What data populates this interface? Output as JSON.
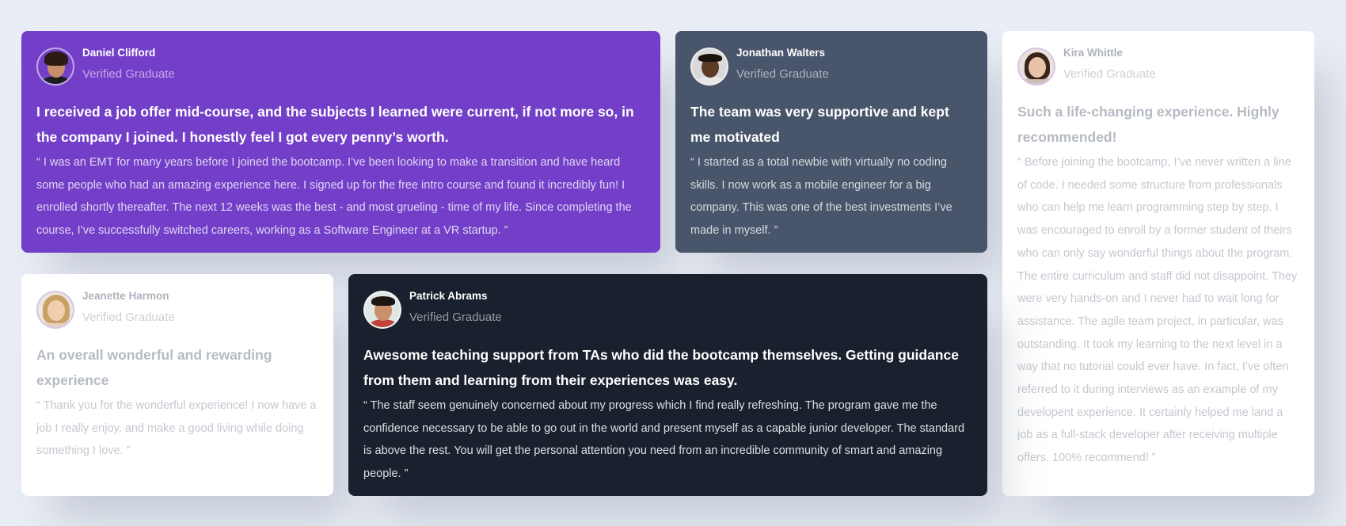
{
  "testimonials": [
    {
      "name": "Daniel Clifford",
      "role": "Verified Graduate",
      "headline": "I received a job offer mid-course, and the subjects I learned were current, if not more so, in the company I joined. I honestly feel I got every penny’s worth.",
      "quote": "“ I was an EMT for many years before I joined the bootcamp. I’ve been looking to make a transition and have heard some people who had an amazing experience here. I signed up for the free intro course and found it incredibly fun! I enrolled shortly thereafter. The next 12 weeks was the best - and most grueling - time of my life. Since completing the course, I’ve successfully switched careers, working as a Software Engineer at a VR startup. ”",
      "avatar_colors": {
        "face": "#c68f6a",
        "hair": "#2b1b12",
        "body": "#1c1c1c"
      }
    },
    {
      "name": "Jonathan Walters",
      "role": "Verified Graduate",
      "headline": "The team was very supportive and kept me motivated",
      "quote": "“ I started as a total newbie with virtually no coding skills. I now work as a mobile engineer for a big company. This was one of the best investments I’ve made in myself. ”",
      "avatar_colors": {
        "face": "#5b3a26",
        "hair": "#1a120c",
        "body": "#e8e8e8"
      }
    },
    {
      "name": "Kira Whittle",
      "role": "Verified Graduate",
      "headline": "Such a life-changing experience. Highly recommended!",
      "quote": "“ Before joining the bootcamp, I’ve never written a line of code. I needed some structure from professionals who can help me learn programming step by step. I was encouraged to enroll by a former student of theirs who can only say wonderful things about the program. The entire curriculum and staff did not disappoint. They were very hands-on and I never had to wait long for assistance. The agile team project, in particular, was outstanding. It took my learning to the next level in a way that no tutorial could ever have. In fact, I’ve often referred to it during interviews as an example of my developent experience. It certainly helped me land a job as a full-stack developer after receiving multiple offers. 100% recommend! ”",
      "avatar_colors": {
        "face": "#e8c3a8",
        "hair": "#3a2318",
        "body": "#ccbfb6"
      }
    },
    {
      "name": "Jeanette Harmon",
      "role": "Verified Graduate",
      "headline": "An overall wonderful and rewarding experience",
      "quote": "“ Thank you for the wonderful experience! I now have a job I really enjoy, and make a good living while doing something I love. ”",
      "avatar_colors": {
        "face": "#f0cfae",
        "hair": "#c9a168",
        "body": "#e6d3bd"
      }
    },
    {
      "name": "Patrick Abrams",
      "role": "Verified Graduate",
      "headline": "Awesome teaching support from TAs who did the bootcamp themselves. Getting guidance from them and learning from their experiences was easy.",
      "quote": "“ The staff seem genuinely concerned about my progress which I find really refreshing. The program gave me the confidence necessary to be able to go out in the world and present myself as a capable junior developer. The standard is above the rest. You will get the personal attention you need from an incredible community of smart and amazing people. ”",
      "avatar_colors": {
        "face": "#c9906b",
        "hair": "#1e1612",
        "body": "#c0433a"
      }
    }
  ]
}
